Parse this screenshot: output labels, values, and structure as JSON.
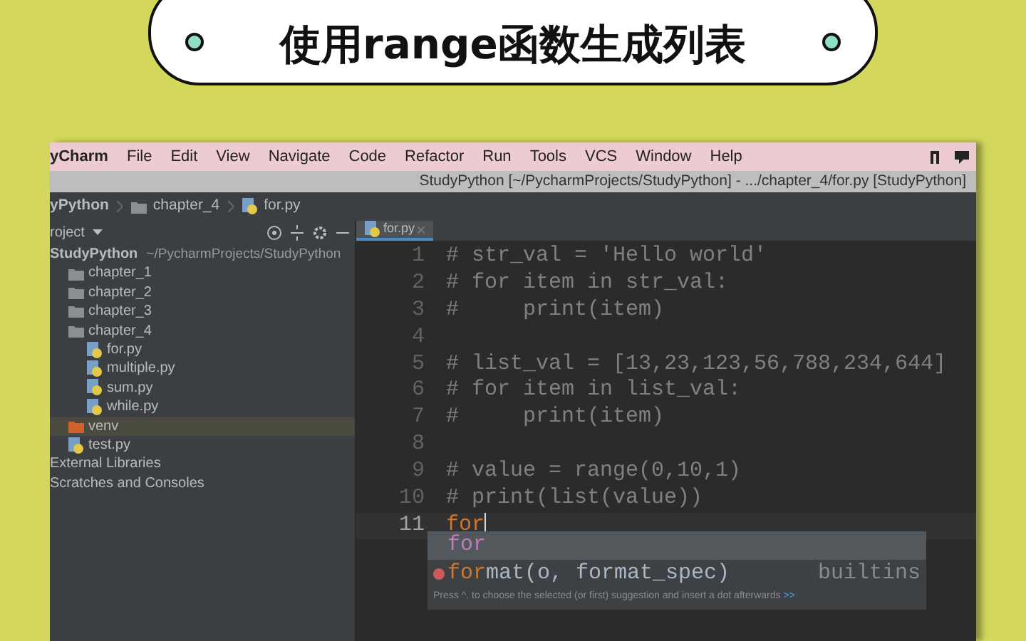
{
  "banner": {
    "title": "使用range函数生成列表"
  },
  "menu_bar": {
    "app_name": "yCharm",
    "items": [
      "File",
      "Edit",
      "View",
      "Navigate",
      "Code",
      "Refactor",
      "Run",
      "Tools",
      "VCS",
      "Window",
      "Help"
    ]
  },
  "title_bar": {
    "text": "StudyPython [~/PycharmProjects/StudyPython] - .../chapter_4/for.py [StudyPython]"
  },
  "breadcrumb": [
    {
      "kind": "project",
      "label": "yPython"
    },
    {
      "kind": "folder",
      "label": "chapter_4"
    },
    {
      "kind": "file",
      "label": "for.py"
    }
  ],
  "project_panel": {
    "title": "roject",
    "tree": [
      {
        "kind": "project",
        "label": "StudyPython",
        "path": "~/PycharmProjects/StudyPython",
        "selected": false,
        "children": [
          {
            "kind": "folder",
            "label": "chapter_1",
            "selected": false
          },
          {
            "kind": "folder",
            "label": "chapter_2",
            "selected": false
          },
          {
            "kind": "folder",
            "label": "chapter_3",
            "selected": false
          },
          {
            "kind": "folder",
            "label": "chapter_4",
            "selected": false,
            "children": [
              {
                "kind": "file",
                "label": "for.py",
                "selected": false
              },
              {
                "kind": "file",
                "label": "multiple.py",
                "selected": false
              },
              {
                "kind": "file",
                "label": "sum.py",
                "selected": false
              },
              {
                "kind": "file",
                "label": "while.py",
                "selected": false
              }
            ]
          },
          {
            "kind": "excluded",
            "label": "venv",
            "selected": true
          },
          {
            "kind": "file",
            "label": "test.py",
            "selected": false
          }
        ]
      },
      {
        "kind": "library",
        "label": "External Libraries",
        "selected": false
      },
      {
        "kind": "library",
        "label": "Scratches and Consoles",
        "selected": false
      }
    ]
  },
  "editor": {
    "tabs": [
      {
        "label": "for.py",
        "selected": true
      }
    ],
    "lines": [
      {
        "number": "1",
        "text": "# str_val = 'Hello world'",
        "kind": "comment",
        "current": false
      },
      {
        "number": "2",
        "text": "# for item in str_val:",
        "kind": "comment",
        "current": false
      },
      {
        "number": "3",
        "text": "#     print(item)",
        "kind": "comment",
        "current": false
      },
      {
        "number": "4",
        "current": false
      },
      {
        "number": "5",
        "text": "# list_val = [13,23,123,56,788,234,644]",
        "kind": "comment",
        "current": false
      },
      {
        "number": "6",
        "text": "# for item in list_val:",
        "kind": "comment",
        "current": false
      },
      {
        "number": "7",
        "text": "#     print(item)",
        "kind": "comment",
        "current": false
      },
      {
        "number": "8",
        "current": false
      },
      {
        "number": "9",
        "text": "# value = range(0,10,1)",
        "kind": "comment",
        "current": false
      },
      {
        "number": "10",
        "text": "# print(list(value))",
        "kind": "comment",
        "current": false
      },
      {
        "number": "11",
        "text": "for",
        "kind": "keyword",
        "current": true
      }
    ],
    "completion": {
      "items": [
        {
          "kind": "keyword",
          "match": "for",
          "selected": true
        },
        {
          "kind": "function",
          "match": "for",
          "rest": "mat(o, format_spec)",
          "source": "builtins",
          "selected": false
        }
      ],
      "hint": "Press ^. to choose the selected (or first) suggestion and insert a dot afterwards",
      "hint_link": ">>"
    }
  }
}
